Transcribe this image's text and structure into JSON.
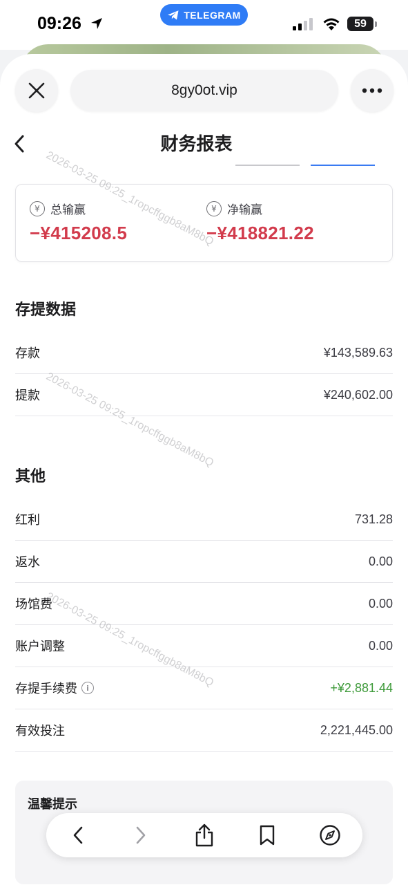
{
  "status_bar": {
    "time": "09:26",
    "telegram_label": "TELEGRAM",
    "battery": "59"
  },
  "browser": {
    "url": "8gy0ot.vip"
  },
  "page": {
    "title": "财务报表",
    "summary": {
      "total_label": "总输赢",
      "total_value": "−¥415208.5",
      "net_label": "净输赢",
      "net_value": "−¥418821.22",
      "currency_icon": "¥"
    },
    "deposit_section": {
      "title": "存提数据",
      "rows": [
        {
          "label": "存款",
          "value": "¥143,589.63"
        },
        {
          "label": "提款",
          "value": "¥240,602.00"
        }
      ]
    },
    "other_section": {
      "title": "其他",
      "rows": [
        {
          "label": "红利",
          "value": "731.28"
        },
        {
          "label": "返水",
          "value": "0.00"
        },
        {
          "label": "场馆费",
          "value": "0.00"
        },
        {
          "label": "账户调整",
          "value": "0.00"
        },
        {
          "label": "存提手续费",
          "value": "+¥2,881.44"
        },
        {
          "label": "有效投注",
          "value": "2,221,445.00"
        }
      ]
    },
    "tips": {
      "title": "温馨提示"
    },
    "watermark": "2026-03-25 09:25_1ropcffggb8aM8bQ"
  },
  "colors": {
    "negative": "#d23b4c",
    "positive": "#3e9a3a",
    "accent": "#3a7bf2",
    "telegram": "#2f7cf6"
  },
  "icons": {
    "close": "close-icon",
    "more": "more-icon",
    "back": "chevron-left-icon",
    "info": "info-icon",
    "share": "share-icon",
    "bookmark": "bookmark-icon",
    "compass": "compass-icon"
  }
}
